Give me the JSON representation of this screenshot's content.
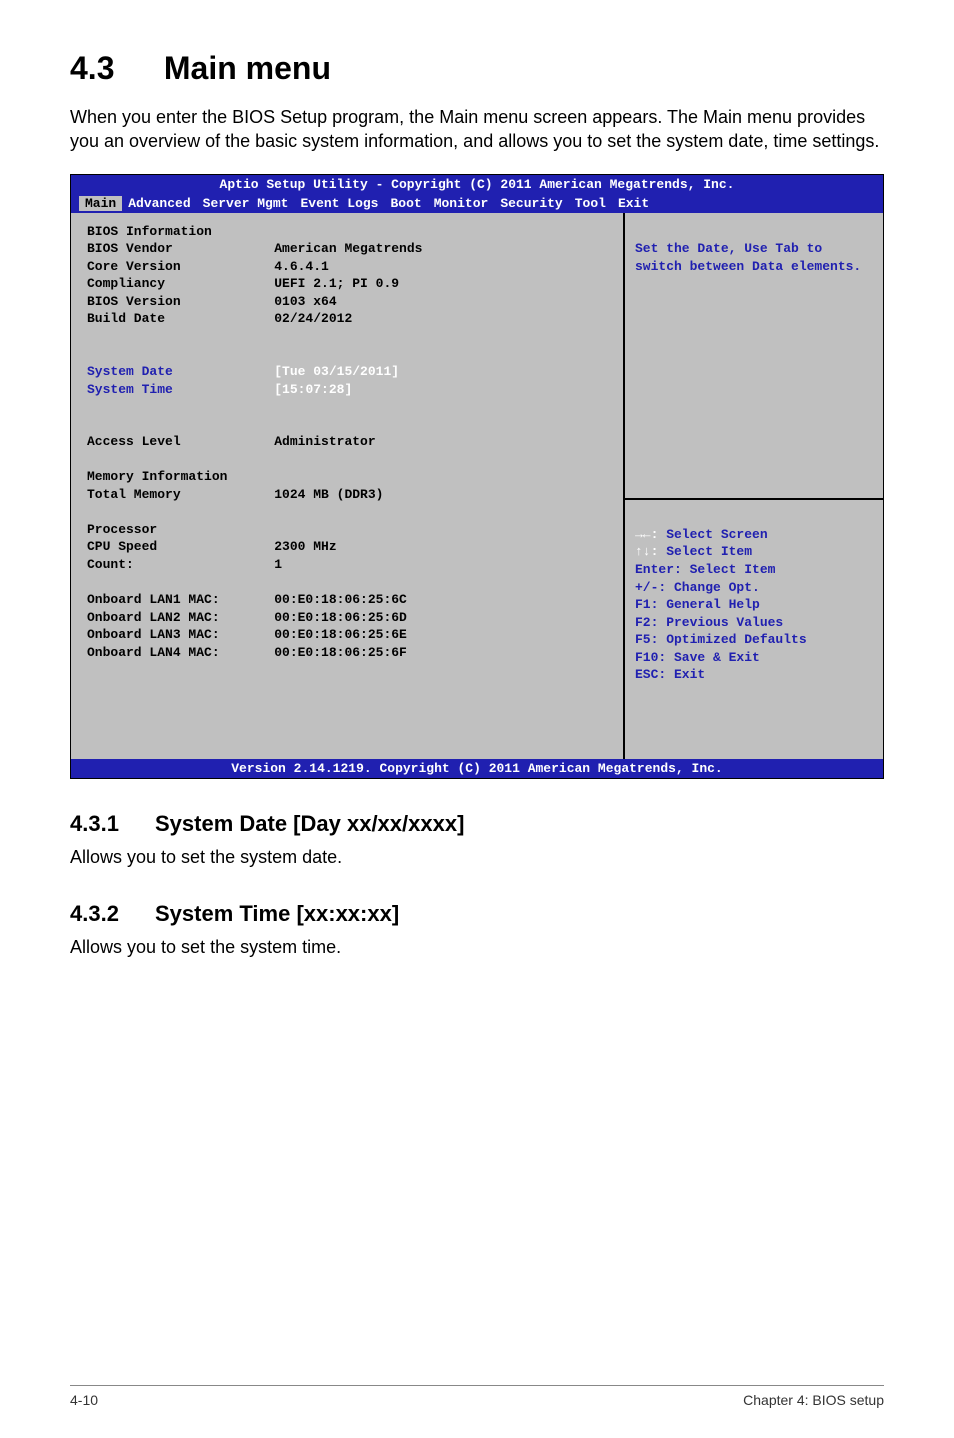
{
  "heading": {
    "num": "4.3",
    "title": "Main menu"
  },
  "intro": "When you enter the BIOS Setup program, the Main menu screen appears. The Main menu provides you an overview of the basic system information, and allows you to set the system date, time settings.",
  "bios": {
    "header": "Aptio Setup Utility - Copyright (C) 2011 American Megatrends, Inc.",
    "tabs": [
      "Main",
      "Advanced",
      "Server Mgmt",
      "Event Logs",
      "Boot",
      "Monitor",
      "Security",
      "Tool",
      "Exit"
    ],
    "active_tab": "Main",
    "rows": [
      {
        "label": "BIOS Information",
        "value": ""
      },
      {
        "label": "BIOS Vendor",
        "value": "American Megatrends"
      },
      {
        "label": "Core Version",
        "value": "4.6.4.1"
      },
      {
        "label": "Compliancy",
        "value": "UEFI 2.1; PI 0.9"
      },
      {
        "label": "BIOS Version",
        "value": "0103 x64"
      },
      {
        "label": "Build Date",
        "value": "02/24/2012"
      },
      {
        "label": "",
        "value": ""
      },
      {
        "label": "",
        "value": ""
      },
      {
        "label": "System Date",
        "value": "[Tue 03/15/2011]",
        "highlight": true
      },
      {
        "label": "System Time",
        "value": "[15:07:28]",
        "highlight": true
      },
      {
        "label": "",
        "value": ""
      },
      {
        "label": "",
        "value": ""
      },
      {
        "label": "Access Level",
        "value": "Administrator"
      },
      {
        "label": "",
        "value": ""
      },
      {
        "label": "Memory Information",
        "value": ""
      },
      {
        "label": "Total Memory",
        "value": "1024 MB (DDR3)"
      },
      {
        "label": "",
        "value": ""
      },
      {
        "label": "Processor",
        "value": ""
      },
      {
        "label": "CPU Speed",
        "value": "2300 MHz"
      },
      {
        "label": "Count:",
        "value": "1"
      },
      {
        "label": "",
        "value": ""
      },
      {
        "label": "Onboard LAN1 MAC:",
        "value": "00:E0:18:06:25:6C"
      },
      {
        "label": "Onboard LAN2 MAC:",
        "value": "00:E0:18:06:25:6D"
      },
      {
        "label": "Onboard LAN3 MAC:",
        "value": "00:E0:18:06:25:6E"
      },
      {
        "label": "Onboard LAN4 MAC:",
        "value": "00:E0:18:06:25:6F"
      }
    ],
    "help_top": "Set the Date, Use Tab to switch between Data elements.",
    "legend": [
      "→←: Select Screen",
      "↑↓:  Select Item",
      "Enter: Select Item",
      "+/-: Change Opt.",
      "F1: General Help",
      "F2: Previous Values",
      "F5: Optimized Defaults",
      "F10: Save & Exit",
      "ESC: Exit"
    ],
    "footer": "Version 2.14.1219. Copyright (C) 2011 American Megatrends, Inc."
  },
  "subsections": [
    {
      "num": "4.3.1",
      "title": "System Date [Day xx/xx/xxxx]",
      "text": "Allows you to set the system date."
    },
    {
      "num": "4.3.2",
      "title": "System Time [xx:xx:xx]",
      "text": "Allows you to set the system time."
    }
  ],
  "page_footer": {
    "left": "4-10",
    "right": "Chapter 4: BIOS setup"
  }
}
